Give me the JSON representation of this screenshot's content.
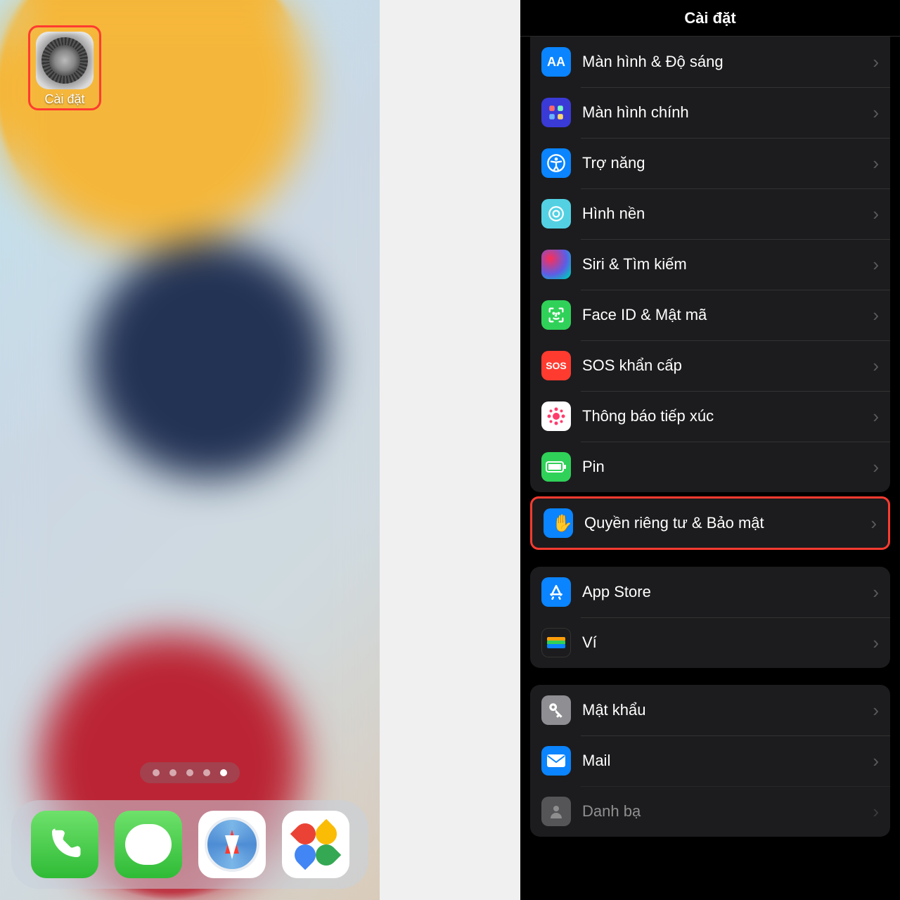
{
  "left": {
    "app_label": "Cài đặt",
    "dock": [
      "phone",
      "messages",
      "safari",
      "photos"
    ],
    "page_count": 5,
    "active_page": 5
  },
  "right": {
    "title": "Cài đặt",
    "group1": [
      {
        "key": "display",
        "label": "Màn hình & Độ sáng"
      },
      {
        "key": "home",
        "label": "Màn hình chính"
      },
      {
        "key": "accessibility",
        "label": "Trợ năng"
      },
      {
        "key": "wallpaper",
        "label": "Hình nền"
      },
      {
        "key": "siri",
        "label": "Siri & Tìm kiếm"
      },
      {
        "key": "faceid",
        "label": "Face ID & Mật mã"
      },
      {
        "key": "sos",
        "label": "SOS khẩn cấp"
      },
      {
        "key": "exposure",
        "label": "Thông báo tiếp xúc"
      },
      {
        "key": "battery",
        "label": "Pin"
      }
    ],
    "privacy": {
      "key": "privacy",
      "label": "Quyền riêng tư & Bảo mật"
    },
    "group2": [
      {
        "key": "appstore",
        "label": "App Store"
      },
      {
        "key": "wallet",
        "label": "Ví"
      }
    ],
    "group3": [
      {
        "key": "passwords",
        "label": "Mật khẩu"
      },
      {
        "key": "mail",
        "label": "Mail"
      },
      {
        "key": "contacts",
        "label": "Danh bạ"
      }
    ],
    "sos_text": "SOS"
  }
}
